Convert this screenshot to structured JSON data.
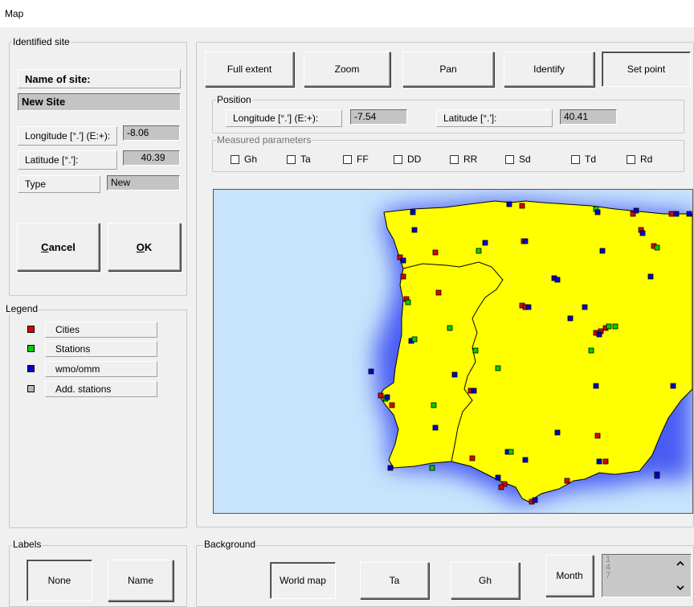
{
  "window": {
    "title": "Map"
  },
  "identified_site": {
    "group_label": "Identified site",
    "name_label": "Name of site:",
    "name_value": "New Site",
    "longitude_label": "Longitude [°.'] (E:+):",
    "longitude_value": "-8.06",
    "latitude_label": "Latitude [°.']:",
    "latitude_value": "40.39",
    "type_label": "Type",
    "type_value": "New",
    "cancel_label_underlined": "C",
    "cancel_label_rest": "ancel",
    "ok_label_underlined": "O",
    "ok_label_rest": "K"
  },
  "legend": {
    "group_label": "Legend",
    "items": [
      {
        "label": "Cities",
        "color": "#e00000"
      },
      {
        "label": "Stations",
        "color": "#00d000"
      },
      {
        "label": "wmo/omm",
        "color": "#0000d0"
      },
      {
        "label": "Add. stations",
        "color": "#b8b8b8"
      }
    ]
  },
  "toolbar": {
    "buttons": [
      {
        "label": "Full extent",
        "pressed": false
      },
      {
        "label": "Zoom",
        "pressed": false
      },
      {
        "label": "Pan",
        "pressed": false
      },
      {
        "label": "Identify",
        "pressed": false
      },
      {
        "label": "Set point",
        "pressed": true
      }
    ]
  },
  "position": {
    "group_label": "Position",
    "longitude_label": "Longitude [°.'] (E:+):",
    "longitude_value": "-7.54",
    "latitude_label": "Latitude [°.']:",
    "latitude_value": "40.41"
  },
  "measured_parameters": {
    "group_label": "Measured parameters",
    "items": [
      "Gh",
      "Ta",
      "FF",
      "DD",
      "RR",
      "Sd",
      "Td",
      "Rd"
    ]
  },
  "map": {
    "sea_color": "#c8e4fc",
    "land_color": "#ffff00",
    "coast_color": "#3a4ef0",
    "point_icon": "square-marker"
  },
  "labels": {
    "group_label": "Labels",
    "none_label": "None",
    "name_label": "Name"
  },
  "background": {
    "group_label": "Background",
    "world_map_label": "World map",
    "ta_label": "Ta",
    "gh_label": "Gh",
    "month_label": "Month",
    "month_list": [
      "1",
      "4",
      "7"
    ],
    "scroll_up_icon": "chevron-up-icon",
    "scroll_down_icon": "chevron-down-icon"
  }
}
